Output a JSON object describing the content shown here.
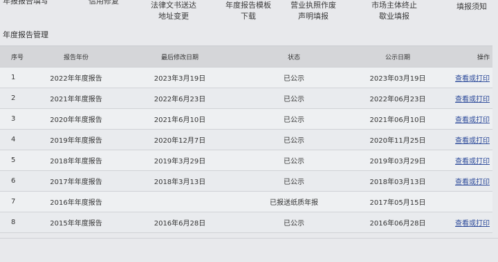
{
  "nav": {
    "items": [
      "年报报告填写",
      "信用修复",
      "法律文书送达\n地址变更",
      "年度报告模板\n下载",
      "营业执照作废\n声明填报",
      "市场主体终止\n歇业填报",
      "填报须知"
    ]
  },
  "section": {
    "title": "年度报告管理"
  },
  "table": {
    "headers": [
      "序号",
      "报告年份",
      "最后修改日期",
      "状态",
      "公示日期",
      "操作"
    ],
    "rows": [
      [
        "1",
        "2022年年度报告",
        "2023年3月19日",
        "已公示",
        "2023年03月19日",
        "查看或打印"
      ],
      [
        "2",
        "2021年年度报告",
        "2022年6月23日",
        "已公示",
        "2022年06月23日",
        "查看或打印"
      ],
      [
        "3",
        "2020年年度报告",
        "2021年6月10日",
        "已公示",
        "2021年06月10日",
        "查看或打印"
      ],
      [
        "4",
        "2019年年度报告",
        "2020年12月7日",
        "已公示",
        "2020年11月25日",
        "查看或打印"
      ],
      [
        "5",
        "2018年年度报告",
        "2019年3月29日",
        "已公示",
        "2019年03月29日",
        "查看或打印"
      ],
      [
        "6",
        "2017年年度报告",
        "2018年3月13日",
        "已公示",
        "2018年03月13日",
        "查看或打印"
      ],
      [
        "7",
        "2016年年度报告",
        "",
        "已报送纸质年报",
        "2017年05月15日",
        ""
      ],
      [
        "8",
        "2015年年度报告",
        "2016年6月28日",
        "已公示",
        "2016年06月28日",
        "查看或打印"
      ]
    ]
  }
}
